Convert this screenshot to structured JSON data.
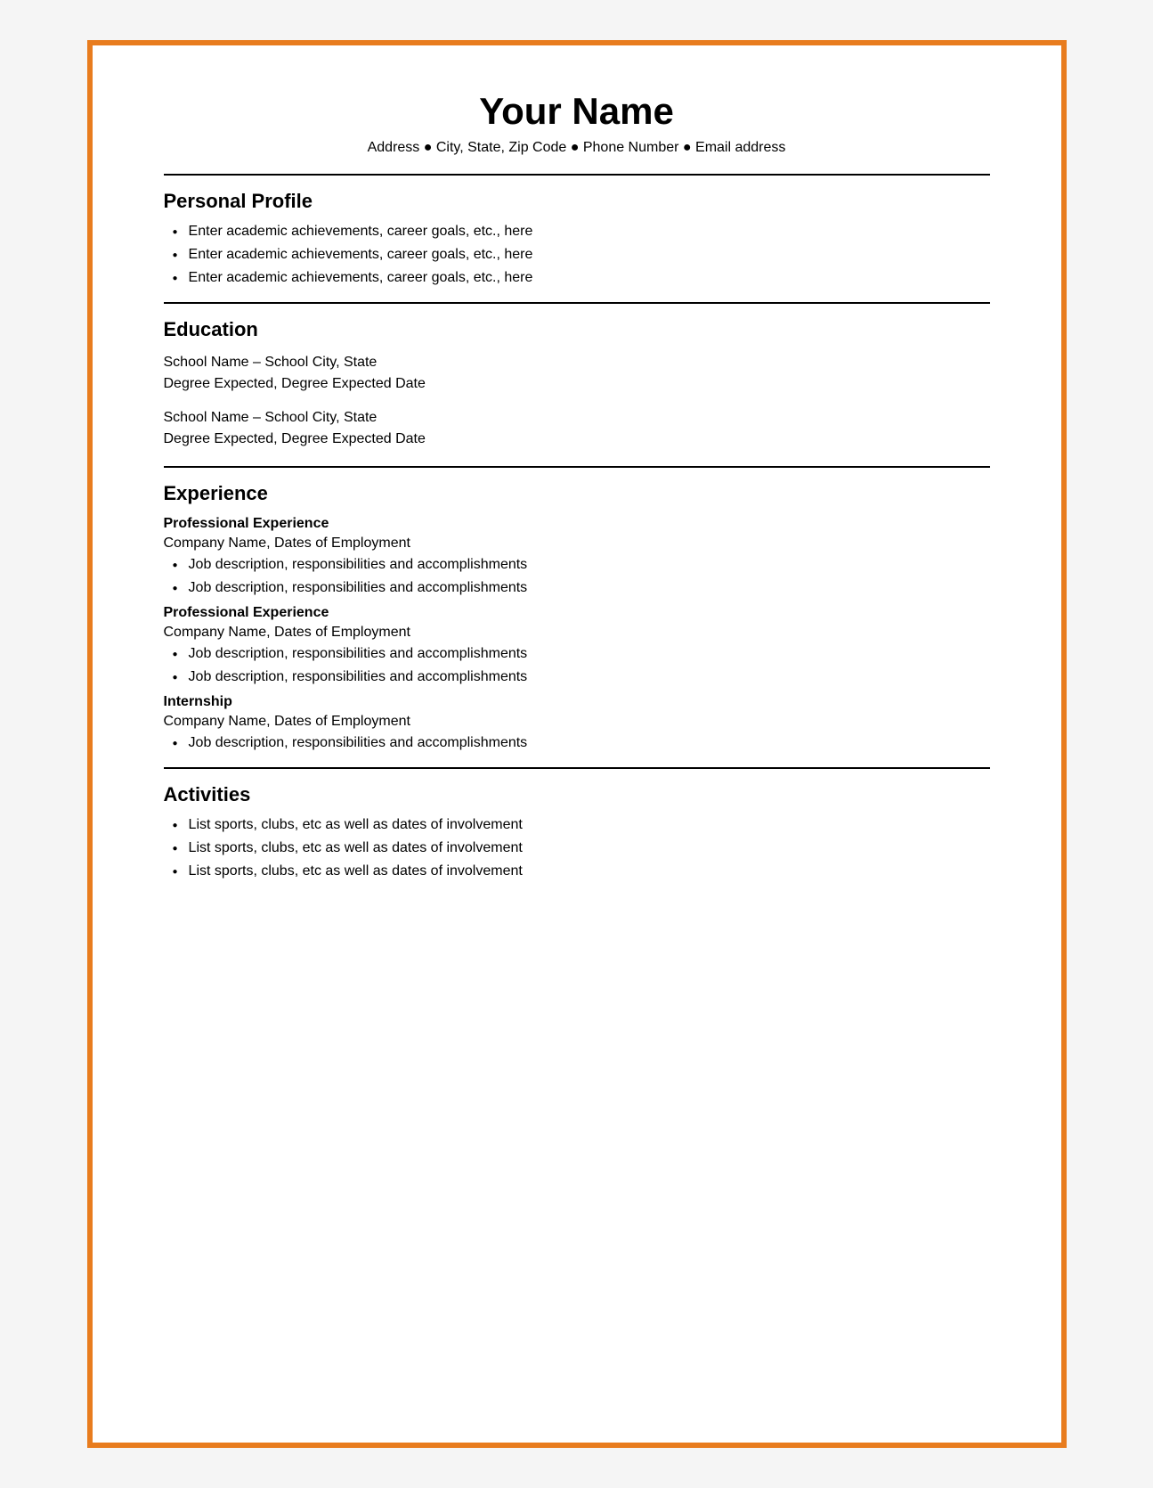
{
  "header": {
    "name": "Your Name",
    "contact": "Address  ●  City, State, Zip Code ●  Phone Number  ●  Email address"
  },
  "sections": {
    "personal_profile": {
      "title": "Personal Profile",
      "items": [
        "Enter academic achievements, career goals, etc., here",
        "Enter academic achievements, career goals, etc., here",
        "Enter academic achievements, career goals, etc., here"
      ]
    },
    "education": {
      "title": "Education",
      "entries": [
        {
          "school": "School Name – School City, State",
          "degree": "Degree Expected, Degree Expected Date"
        },
        {
          "school": "School Name – School City, State",
          "degree": "Degree Expected, Degree Expected Date"
        }
      ]
    },
    "experience": {
      "title": "Experience",
      "sub_sections": [
        {
          "sub_title": "Professional Experience",
          "company": "Company Name, Dates of Employment",
          "items": [
            "Job description, responsibilities and accomplishments",
            "Job description, responsibilities and accomplishments"
          ]
        },
        {
          "sub_title": "Professional Experience",
          "company": "Company Name, Dates of Employment",
          "items": [
            "Job description, responsibilities and accomplishments",
            "Job description, responsibilities and accomplishments"
          ]
        },
        {
          "sub_title": "Internship",
          "company": "Company Name, Dates of Employment",
          "items": [
            "Job description, responsibilities and accomplishments"
          ]
        }
      ]
    },
    "activities": {
      "title": "Activities",
      "items": [
        "List sports, clubs, etc as well as dates of involvement",
        "List sports, clubs, etc as well as dates of involvement",
        "List sports, clubs, etc as well as dates of involvement"
      ]
    }
  }
}
